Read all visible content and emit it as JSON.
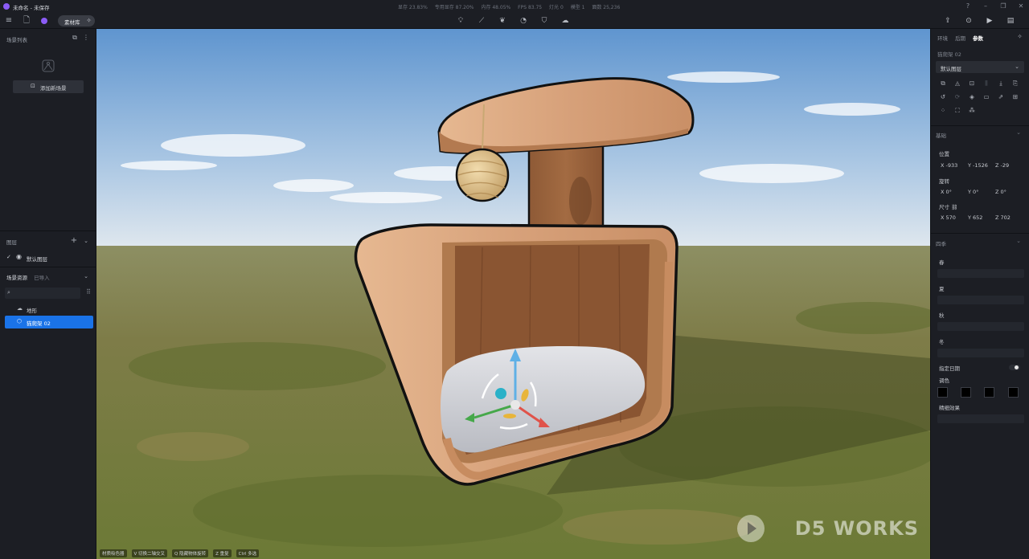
{
  "titlebar": {
    "doc_title": "未命名 - 未保存",
    "stats": [
      "显存 23.83%",
      "专用显存 87.20%",
      "内存 48.05%",
      "FPS 83.75",
      "灯光 0",
      "模型 1",
      "面数 25,236"
    ]
  },
  "toolbar": {
    "library_label": "素材库",
    "mid_tool_icons": [
      "bulb-icon",
      "path-icon",
      "leaf-icon",
      "weather-icon",
      "particle-icon",
      "terrain-icon"
    ],
    "right_tool_icons": [
      "share-icon",
      "camera-icon",
      "video-icon",
      "render-queue-icon"
    ]
  },
  "left_panel": {
    "scene_list_title": "场景列表",
    "add_scene_label": "添加新场景",
    "layers_title": "图层",
    "default_layer": "默认图层",
    "assets_tab_scene": "场景资源",
    "assets_tab_imported": "已导入",
    "tree": [
      {
        "label": "地形",
        "icon": "terrain-icon",
        "selected": false
      },
      {
        "label": "猫爬架 02",
        "icon": "cube-icon",
        "selected": true
      }
    ]
  },
  "viewport": {
    "shortcuts": [
      "材质吸色器",
      "V 切换二轴交叉",
      "Q 隐藏物体旋转",
      "Z 重复",
      "Ctrl 多选"
    ],
    "watermark": "D5 WORKS"
  },
  "right_panel": {
    "tabs": [
      "环境",
      "后期",
      "参数"
    ],
    "active_tab": "参数",
    "object_name": "猫爬架 02",
    "layer_select": "默认图层",
    "basic_title": "基础",
    "position_label": "位置",
    "position": {
      "x": "X -933",
      "y": "Y -1526",
      "z": "Z -29"
    },
    "rotation_label": "旋转",
    "rotation": {
      "x": "X 0°",
      "y": "Y 0°",
      "z": "Z 0°"
    },
    "size_label": "尺寸",
    "size": {
      "x": "X 570",
      "y": "Y 652",
      "z": "Z 702"
    },
    "seasons_title": "四季",
    "seasons": [
      "春",
      "夏",
      "秋",
      "冬"
    ],
    "fixed_date_label": "指定日期",
    "tint_label": "调色",
    "fine_effect_label": "精细效果",
    "swatch_color": "#000000"
  },
  "colors": {
    "accent": "#1a73e8",
    "panel_bg": "#1c1e24",
    "brand_purple": "#8b5cf6"
  }
}
